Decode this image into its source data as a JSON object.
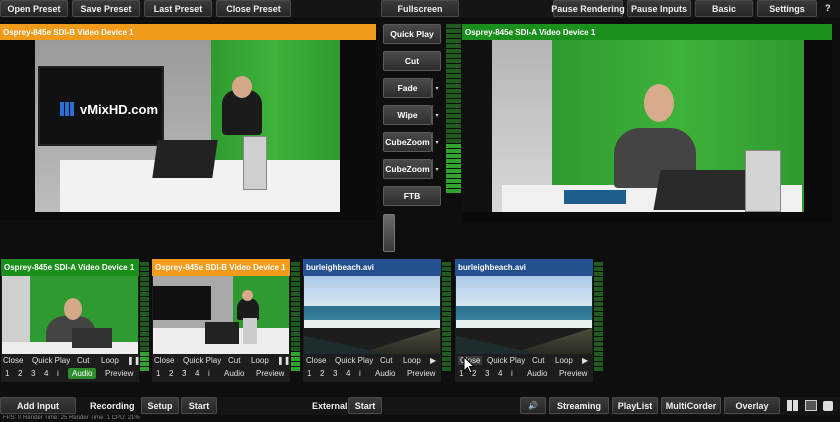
{
  "toolbar": {
    "open_preset": "Open Preset",
    "save_preset": "Save Preset",
    "last_preset": "Last Preset",
    "close_preset": "Close Preset",
    "fullscreen": "Fullscreen",
    "pause_rendering": "Pause Rendering",
    "pause_inputs": "Pause Inputs",
    "basic": "Basic",
    "settings": "Settings",
    "help": "?"
  },
  "preview": {
    "title": "Osprey-845e SDI-B Video Device 1",
    "logo_text": "vMixHD.com"
  },
  "output": {
    "title": "Osprey-845e SDI-A Video Device 1"
  },
  "transitions": {
    "quick_play": "Quick Play",
    "cut": "Cut",
    "fade": "Fade",
    "wipe": "Wipe",
    "cubezoom1": "CubeZoom",
    "cubezoom2": "CubeZoom",
    "ftb": "FTB",
    "dropdown": "▾"
  },
  "inputs": [
    {
      "title": "Osprey-845e SDI-A Video Device 1",
      "color": "green",
      "close": "Close",
      "quick_play": "Quick Play",
      "cut": "Cut",
      "loop": "Loop",
      "play": "❚❚",
      "n1": "1",
      "n2": "2",
      "n3": "3",
      "n4": "4",
      "info": "i",
      "audio": "Audio",
      "preview": "Preview"
    },
    {
      "title": "Osprey-845e SDI-B Video Device 1",
      "color": "orange",
      "close": "Close",
      "quick_play": "Quick Play",
      "cut": "Cut",
      "loop": "Loop",
      "play": "❚❚",
      "n1": "1",
      "n2": "2",
      "n3": "3",
      "n4": "4",
      "info": "i",
      "audio": "Audio",
      "preview": "Preview"
    },
    {
      "title": "burleighbeach.avi",
      "color": "blue",
      "close": "Close",
      "quick_play": "Quick Play",
      "cut": "Cut",
      "loop": "Loop",
      "play": "▶",
      "n1": "1",
      "n2": "2",
      "n3": "3",
      "n4": "4",
      "info": "i",
      "audio": "Audio",
      "preview": "Preview"
    },
    {
      "title": "burleighbeach.avi",
      "color": "blue",
      "close": "Close",
      "quick_play": "Quick Play",
      "cut": "Cut",
      "loop": "Loop",
      "play": "▶",
      "n1": "1",
      "n2": "2",
      "n3": "3",
      "n4": "4",
      "info": "i",
      "audio": "Audio",
      "preview": "Preview"
    }
  ],
  "bottom": {
    "add_input": "Add Input",
    "recording": "Recording",
    "setup": "Setup",
    "start_recording": "Start",
    "external": "External",
    "start_external": "Start",
    "volume": "🔊",
    "streaming": "Streaming",
    "playlist": "PlayList",
    "multicorder": "MultiCorder",
    "overlay": "Overlay"
  },
  "status": "FPS: 0  Render Time: 25  Render Time: 1  CPU: 21%"
}
